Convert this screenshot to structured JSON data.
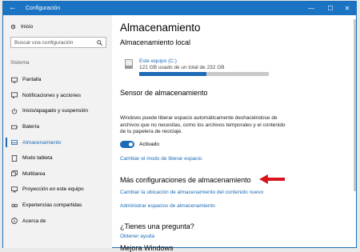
{
  "window": {
    "title": "Configuración",
    "back_glyph": "←",
    "min_glyph": "—",
    "max_glyph": "☐",
    "close_glyph": "✕"
  },
  "sidebar": {
    "home_label": "Inicio",
    "search_placeholder": "Buscar una configuración",
    "section_label": "Sistema",
    "items": [
      {
        "label": "Pantalla",
        "icon": "display-icon"
      },
      {
        "label": "Notificaciones y acciones",
        "icon": "notifications-icon"
      },
      {
        "label": "Inicio/apagado y suspensión",
        "icon": "power-icon"
      },
      {
        "label": "Batería",
        "icon": "battery-icon"
      },
      {
        "label": "Almacenamiento",
        "icon": "storage-icon",
        "active": true
      },
      {
        "label": "Modo tableta",
        "icon": "tablet-icon"
      },
      {
        "label": "Multitarea",
        "icon": "multitasking-icon"
      },
      {
        "label": "Proyección en este equipo",
        "icon": "projection-icon"
      },
      {
        "label": "Experiencias compartidas",
        "icon": "shared-icon"
      },
      {
        "label": "Acerca de",
        "icon": "about-icon"
      }
    ]
  },
  "main": {
    "title": "Almacenamiento",
    "local_heading": "Almacenamiento local",
    "drive": {
      "name": "Este equipo (C:)",
      "usage": "121 GB usado de un total de 232 GB",
      "used_fraction": 0.52
    },
    "sensor_heading": "Sensor de almacenamiento",
    "sensor_text": "Windows puede liberar espacio automáticamente deshaciéndose de archivos que no necesitas, como los archivos temporales y el contenido de tu papelera de reciclaje.",
    "toggle_label": "Activado",
    "toggle_on": true,
    "change_mode_link": "Cambiar el modo de liberar espacio",
    "more_heading": "Más configuraciones de almacenamiento",
    "change_location_link": "Cambiar la ubicación de almacenamiento del contenido nuevo",
    "manage_spaces_link": "Administrar espacios de almacenamiento",
    "question_heading": "¿Tienes una pregunta?",
    "help_link": "Obtener ayuda",
    "improve_heading": "Mejora Windows"
  },
  "colors": {
    "accent": "#1b6bb6",
    "titlebar": "#1b73c4",
    "arrow": "#d9141b"
  }
}
